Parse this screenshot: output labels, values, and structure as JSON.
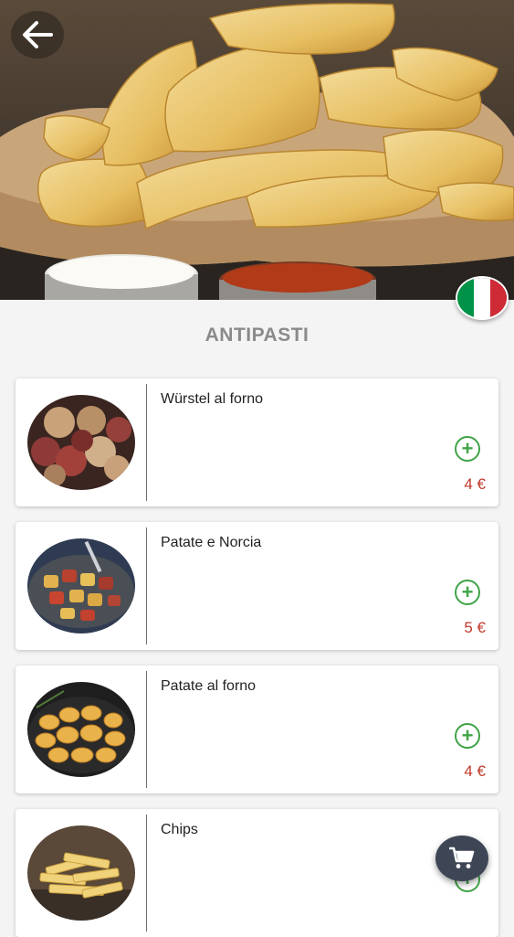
{
  "header": {
    "back_icon": "arrow-left-icon",
    "language_flag": "italy-flag-icon",
    "flag_colors": [
      "#009246",
      "#ffffff",
      "#ce2b37"
    ]
  },
  "section": {
    "title": "ANTIPASTI"
  },
  "menu": {
    "items": [
      {
        "name": "Würstel al forno",
        "price": "4 €",
        "image": "sausages-and-potatoes-photo"
      },
      {
        "name": "Patate e Norcia",
        "price": "5 €",
        "image": "potatoes-with-sausage-photo"
      },
      {
        "name": "Patate al forno",
        "price": "4 €",
        "image": "roasted-potatoes-photo"
      },
      {
        "name": "Chips",
        "price": "",
        "image": "chips-photo"
      }
    ],
    "add_icon": "plus-circle-icon"
  },
  "cart": {
    "icon": "shopping-cart-icon"
  },
  "colors": {
    "price": "#c0392b",
    "add": "#3fa447",
    "fab": "#3e4656",
    "title": "#8a8a8a"
  }
}
